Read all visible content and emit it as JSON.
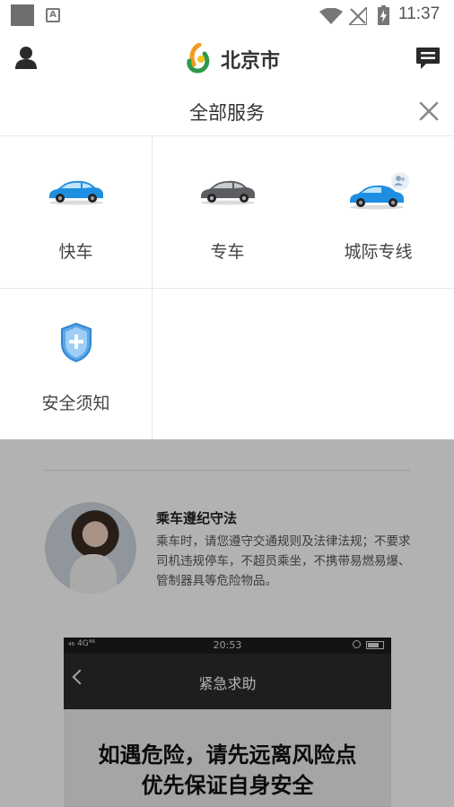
{
  "status_bar": {
    "time": "11:37",
    "notification_icon_letter": "A"
  },
  "header": {
    "city": "北京市"
  },
  "services_panel": {
    "title": "全部服务",
    "items": [
      {
        "label": "快车",
        "icon": "blue-car-icon"
      },
      {
        "label": "专车",
        "icon": "gray-car-icon"
      },
      {
        "label": "城际专线",
        "icon": "carpool-car-icon"
      },
      {
        "label": "安全须知",
        "icon": "shield-icon"
      }
    ]
  },
  "background": {
    "tip_title": "乘车遵纪守法",
    "tip_body": "乘车时，请您遵守交通规则及法律法规；不要求司机违规停车，不超员乘坐，不携带易燃易爆、管制器具等危险物品。",
    "phone_preview": {
      "status_left": "₄₆ 4G⁴⁶",
      "time": "20:53",
      "title": "紧急求助",
      "message_line1": "如遇危险，请先远离风险点",
      "message_line2": "优先保证自身安全"
    }
  },
  "colors": {
    "accent_blue": "#1e8ee0",
    "overlay": "rgba(0,0,0,0.3)"
  }
}
